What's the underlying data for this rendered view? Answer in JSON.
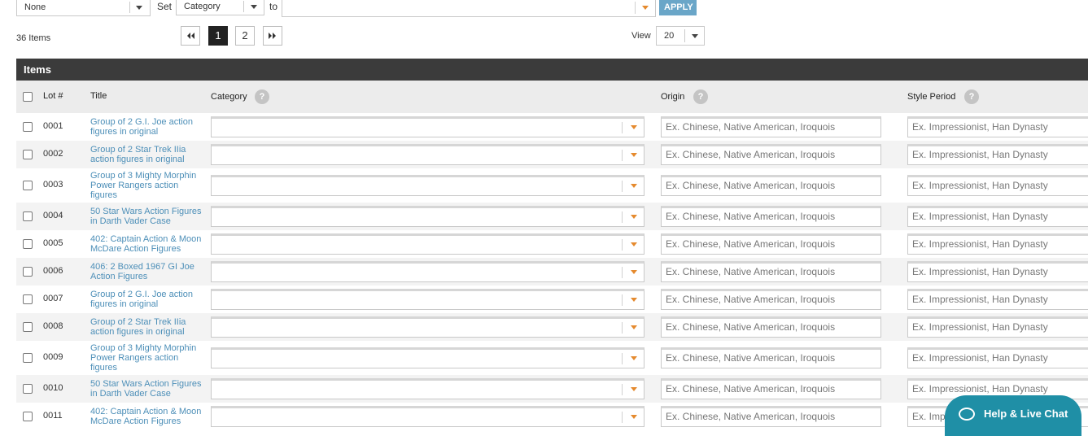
{
  "toolbar": {
    "bulk_select_value": "None",
    "set_label": "Set",
    "field_select_value": "Category",
    "to_label": "to",
    "value_input": "",
    "apply_label": "APPLY"
  },
  "summary": {
    "items_count": "36 Items",
    "view_label": "View",
    "view_value": "20"
  },
  "pagination": {
    "first_icon": "⏮",
    "pages": [
      "1",
      "2"
    ],
    "active_page": "1",
    "last_icon": "⏭"
  },
  "table": {
    "section_title": "Items",
    "headers": {
      "lot": "Lot #",
      "title": "Title",
      "category": "Category",
      "origin": "Origin",
      "style_period": "Style Period",
      "help": "?"
    },
    "origin_placeholder": "Ex. Chinese, Native American, Iroquois",
    "style_placeholder": "Ex. Impressionist, Han Dynasty",
    "rows": [
      {
        "lot": "0001",
        "title": "Group of 2 G.I. Joe action figures in original"
      },
      {
        "lot": "0002",
        "title": "Group of 2 Star Trek IIia action figures in original"
      },
      {
        "lot": "0003",
        "title": "Group of 3 Mighty Morphin Power Rangers action figures"
      },
      {
        "lot": "0004",
        "title": "50 Star Wars Action Figures in Darth Vader Case"
      },
      {
        "lot": "0005",
        "title": "402: Captain Action & Moon McDare Action Figures"
      },
      {
        "lot": "0006",
        "title": "406: 2 Boxed 1967 GI Joe Action Figures"
      },
      {
        "lot": "0007",
        "title": "Group of 2 G.I. Joe action figures in original"
      },
      {
        "lot": "0008",
        "title": "Group of 2 Star Trek IIia action figures in original"
      },
      {
        "lot": "0009",
        "title": "Group of 3 Mighty Morphin Power Rangers action figures"
      },
      {
        "lot": "0010",
        "title": "50 Star Wars Action Figures in Darth Vader Case"
      },
      {
        "lot": "0011",
        "title": "402: Captain Action & Moon McDare Action Figures"
      }
    ]
  },
  "chat": {
    "label": "Help & Live Chat"
  },
  "colors": {
    "accent": "#6aa6c8",
    "link": "#4d8fb8",
    "header_bar": "#3b3b3b",
    "caret_orange": "#e58a2e",
    "chat": "#1f8fa6"
  }
}
